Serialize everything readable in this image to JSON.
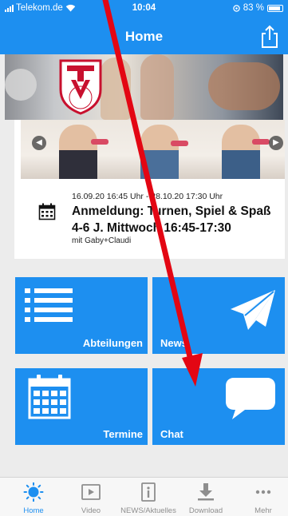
{
  "status_bar": {
    "carrier": "Telekom.de",
    "time": "10:04",
    "battery": "83 %"
  },
  "nav": {
    "title": "Home"
  },
  "event": {
    "date_range": "16.09.20 16:45 Uhr - 28.10.20 17:30 Uhr",
    "title": "Anmeldung: Turnen, Spiel & Spaß 4-6 J. Mittwoch 16:45-17:30",
    "subtitle": "mit Gaby+Claudi"
  },
  "tiles": {
    "abteilungen": "Abteilungen",
    "news": "News",
    "termine": "Termine",
    "chat": "Chat"
  },
  "tab_bar": {
    "items": [
      {
        "label": "Home",
        "icon": "sun-icon",
        "active": true
      },
      {
        "label": "Video",
        "icon": "video-icon",
        "active": false
      },
      {
        "label": "NEWS/Aktuelles",
        "icon": "info-icon",
        "active": false
      },
      {
        "label": "Download",
        "icon": "download-icon",
        "active": false
      },
      {
        "label": "Mehr",
        "icon": "more-icon",
        "active": false
      }
    ]
  },
  "colors": {
    "accent": "#1d8ff0",
    "annotation": "#e30613",
    "tab_inactive": "#8e8e8e"
  }
}
